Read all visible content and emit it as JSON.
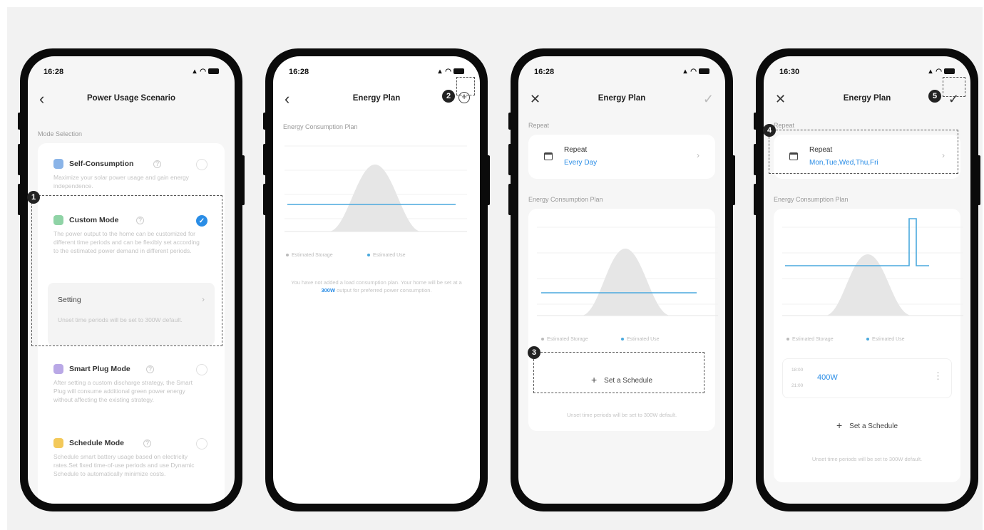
{
  "status": {
    "time_1": "16:28",
    "time_2": "16:28",
    "time_3": "16:28",
    "time_4": "16:30",
    "icons": "◢ ◠"
  },
  "screen1": {
    "title": "Power Usage Scenario",
    "back_icon": "chevron-left",
    "section": "Mode Selection",
    "modes": [
      {
        "title": "Self-Consumption",
        "icon_color": "#8ab4e8",
        "desc": "Maximize your solar power usage and gain energy independence.",
        "checked": false
      },
      {
        "title": "Custom Mode",
        "icon_color": "#8fd3a6",
        "desc": "The power output to the home can be customized for different time periods and can be flexibly set according to the estimated power demand in different periods.",
        "checked": true
      },
      {
        "title": "Smart Plug Mode",
        "icon_color": "#b9a8e6",
        "desc": "After setting a custom discharge strategy, the Smart Plug will consume additional green power energy without affecting the existing strategy.",
        "checked": false
      },
      {
        "title": "Schedule Mode",
        "icon_color": "#f3c95a",
        "desc": "Schedule smart battery usage based on electricity rates.Set fixed time-of-use periods and use Dynamic Schedule to automatically minimize costs.",
        "checked": false
      }
    ],
    "setting_label": "Setting",
    "setting_note": "Unset time periods will be set to 300W default."
  },
  "screen2": {
    "title": "Energy Plan",
    "section": "Energy Consumption Plan",
    "legend_storage": "Estimated Storage",
    "legend_use": "Estimated Use",
    "note_pre": "You have not added a load consumption plan. Your home will be set at a ",
    "note_hl": "300W",
    "note_post": " output for preferred power consumption."
  },
  "screen3": {
    "title": "Energy Plan",
    "section_repeat": "Repeat",
    "repeat_label": "Repeat",
    "repeat_value": "Every Day",
    "section_plan": "Energy Consumption Plan",
    "legend_storage": "Estimated Storage",
    "legend_use": "Estimated Use",
    "schedule_label": "Set a Schedule",
    "note": "Unset time periods will be set to 300W default."
  },
  "screen4": {
    "title": "Energy Plan",
    "section_repeat": "Repeat",
    "repeat_label": "Repeat",
    "repeat_value": "Mon,Tue,Wed,Thu,Fri",
    "section_plan": "Energy Consumption Plan",
    "legend_storage": "Estimated Storage",
    "legend_use": "Estimated Use",
    "slot_start": "18:00",
    "slot_end": "21:00",
    "slot_power": "400W",
    "schedule_label": "Set a Schedule",
    "note": "Unset time periods will be set to 300W default."
  },
  "badges": [
    "1",
    "2",
    "3",
    "4",
    "5"
  ],
  "colors": {
    "accent": "#2a8de6",
    "line": "#4aa9dd",
    "area": "#e4e4e4"
  }
}
